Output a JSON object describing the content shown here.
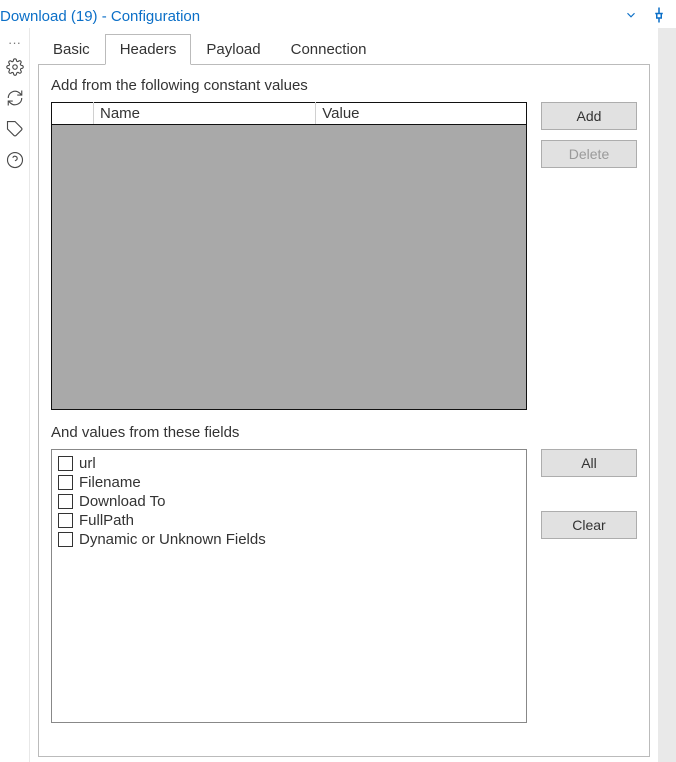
{
  "title": "Download (19) - Configuration",
  "tabs": {
    "basic": "Basic",
    "headers": "Headers",
    "payload": "Payload",
    "connection": "Connection"
  },
  "headers_panel": {
    "constants_label": "Add from the following constant values",
    "table": {
      "col_spacer": "",
      "col_name": "Name",
      "col_value": "Value"
    },
    "add_btn": "Add",
    "delete_btn": "Delete",
    "fields_label": "And values from these fields",
    "fields": [
      "url",
      "Filename",
      "Download To",
      "FullPath",
      "Dynamic or Unknown Fields"
    ],
    "all_btn": "All",
    "clear_btn": "Clear"
  }
}
